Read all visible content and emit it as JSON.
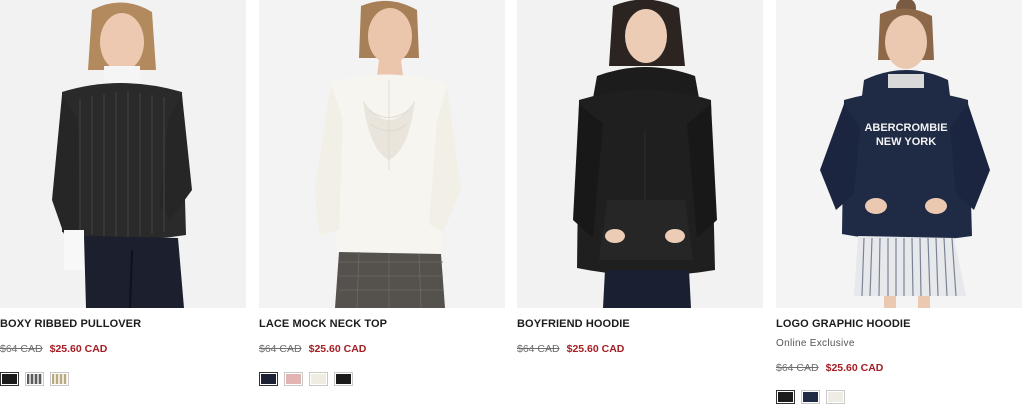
{
  "products": [
    {
      "name": "BOXY RIBBED PULLOVER",
      "tag": "",
      "price_original": "$64 CAD",
      "price_sale": "$25.60 CAD",
      "swatches": [
        {
          "name": "black",
          "color": "#1b1b1b",
          "stripe": false
        },
        {
          "name": "grey-stripe",
          "color": "#8a8a8a",
          "stripe": true
        },
        {
          "name": "cream-stripe",
          "color": "#d9cdb4",
          "stripe": true
        }
      ]
    },
    {
      "name": "LACE MOCK NECK TOP",
      "tag": "",
      "price_original": "$64 CAD",
      "price_sale": "$25.60 CAD",
      "swatches": [
        {
          "name": "navy",
          "color": "#1c2233",
          "stripe": false
        },
        {
          "name": "pink",
          "color": "#e2b5b2",
          "stripe": false
        },
        {
          "name": "cream",
          "color": "#f1ece2",
          "stripe": false
        },
        {
          "name": "black",
          "color": "#1a1a1a",
          "stripe": false
        }
      ]
    },
    {
      "name": "BOYFRIEND HOODIE",
      "tag": "",
      "price_original": "$64 CAD",
      "price_sale": "$25.60 CAD",
      "swatches": []
    },
    {
      "name": "LOGO GRAPHIC HOODIE",
      "tag": "Online Exclusive",
      "price_original": "$64 CAD",
      "price_sale": "$25.60 CAD",
      "graphic_text": [
        "ABERCROMBIE",
        "NEW YORK"
      ],
      "swatches": [
        {
          "name": "black",
          "color": "#1c1c1c",
          "stripe": false
        },
        {
          "name": "navy",
          "color": "#1f2a45",
          "stripe": false
        },
        {
          "name": "cream",
          "color": "#efece6",
          "stripe": false
        }
      ]
    }
  ]
}
